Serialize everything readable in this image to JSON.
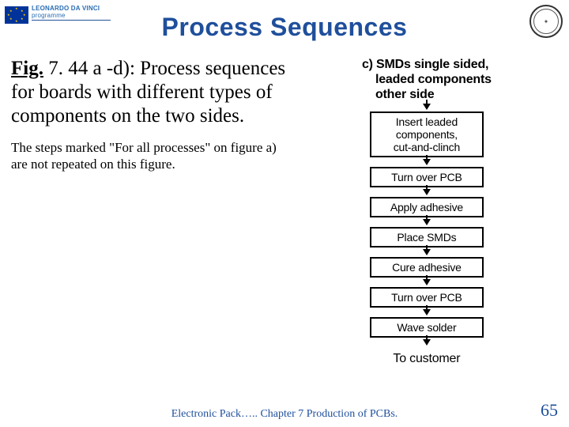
{
  "header": {
    "logo": {
      "line1": "LEONARDO DA VINCI",
      "line2": "programme"
    },
    "title": "Process Sequences"
  },
  "caption": {
    "fig_label": "Fig.",
    "fig_num": " 7. 44 a -d):",
    "body": "Process sequences for boards with different types of components on the two sides."
  },
  "note": "The steps marked \"For all processes\" on figure a) are not repeated on this figure.",
  "diagram": {
    "heading_lines": [
      "c) SMDs single sided,",
      "    leaded components",
      "    other side"
    ],
    "steps": [
      "Insert leaded\ncomponents,\ncut-and-clinch",
      "Turn over PCB",
      "Apply adhesive",
      "Place SMDs",
      "Cure adhesive",
      "Turn over PCB",
      "Wave solder"
    ],
    "end": "To customer"
  },
  "footer": {
    "text": "Electronic Pack…..   Chapter 7 Production of PCBs.",
    "page": "65"
  }
}
